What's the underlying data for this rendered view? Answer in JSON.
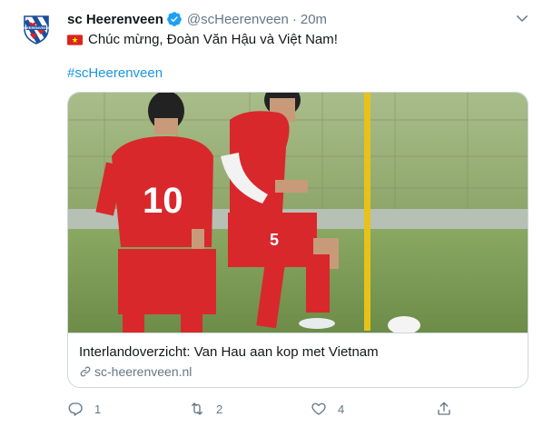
{
  "tweet": {
    "display_name": "sc Heerenveen",
    "handle": "@scHeerenveen",
    "separator": "·",
    "time": "20m",
    "text": "Chúc mừng, Đoàn Văn Hậu và Việt Nam!",
    "hashtag": "#scHeerenveen",
    "verified": true,
    "flag_icon": "vietnam-flag-icon"
  },
  "card": {
    "title": "Interlandoverzicht: Van Hau aan kop met Vietnam",
    "domain": "sc-heerenveen.nl",
    "image_alt": "football-players-training-photo"
  },
  "actions": {
    "reply_count": "1",
    "retweet_count": "2",
    "like_count": "4"
  },
  "colors": {
    "link_blue": "#1b95e0",
    "text_primary": "#14171a",
    "text_secondary": "#657786",
    "border": "#ccd6dd",
    "verified_blue": "#1da1f2"
  }
}
